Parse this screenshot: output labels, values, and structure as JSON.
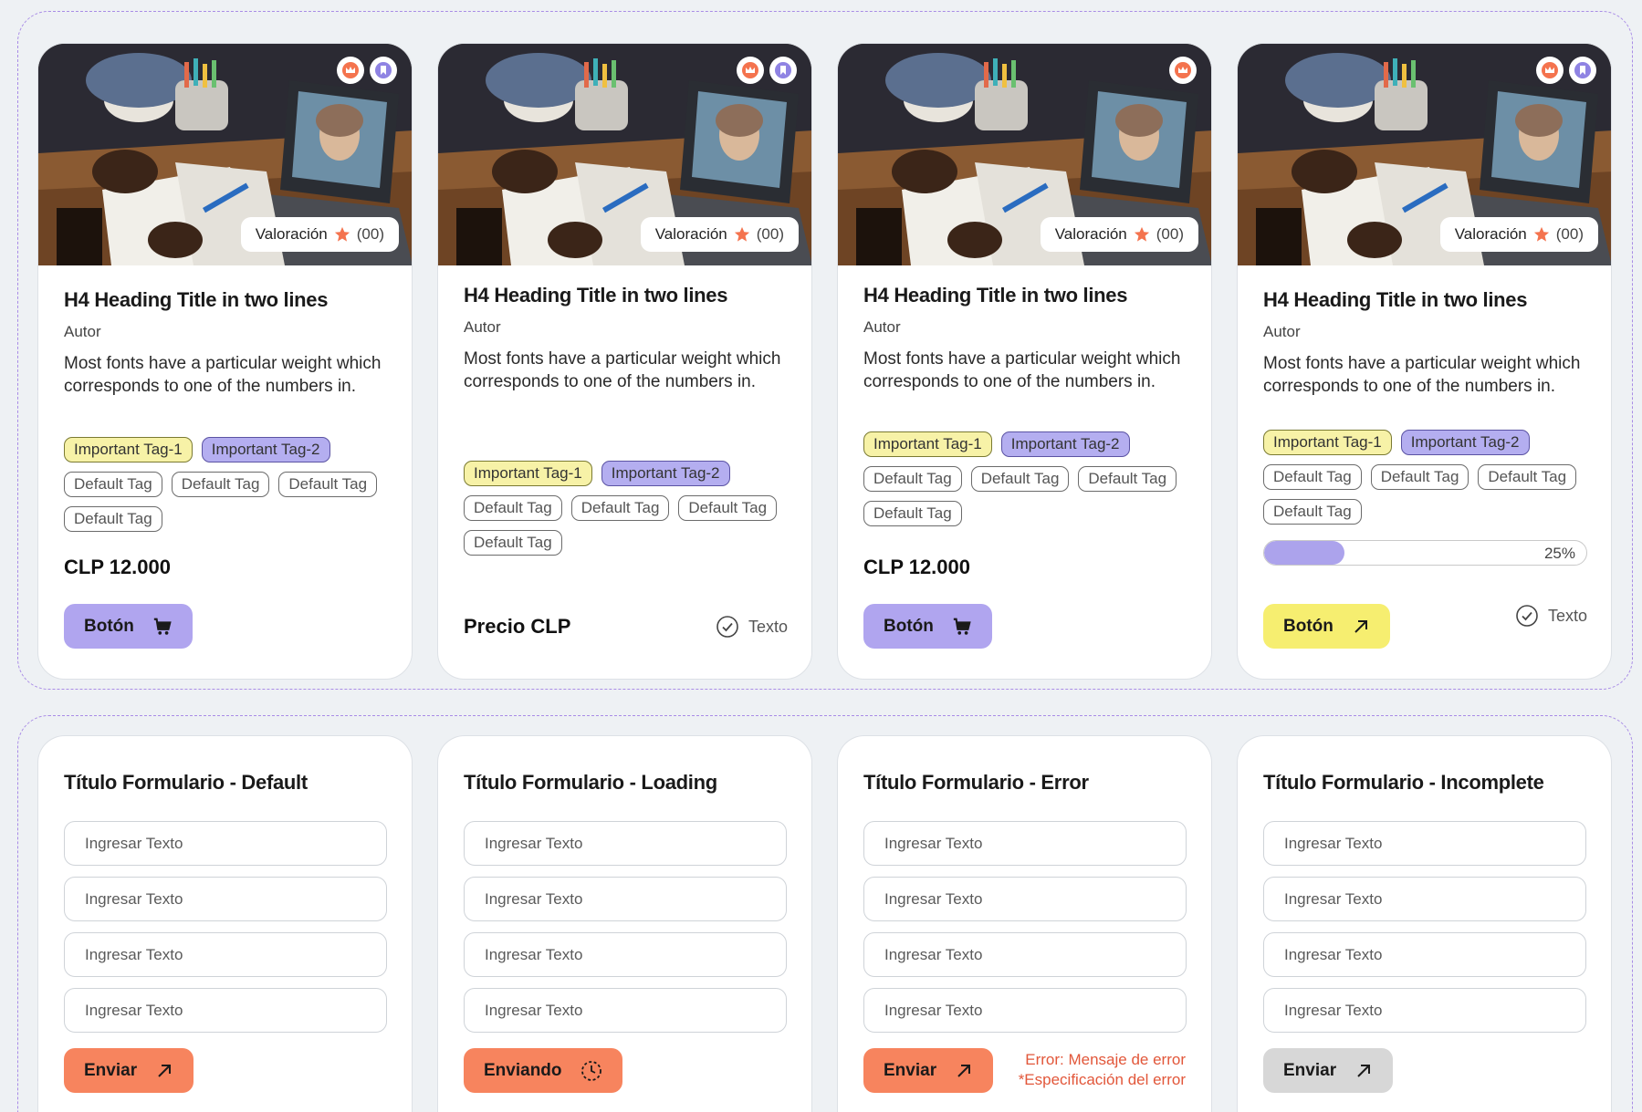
{
  "cards": [
    {
      "rating_label": "Valoración",
      "rating_count": "(00)",
      "title": "H4 Heading Title in two lines",
      "author": "Autor",
      "description": "Most fonts have a particular weight which corresponds to one of the numbers in.",
      "important_tags": [
        "Important Tag-1",
        "Important Tag-2"
      ],
      "default_tags": [
        "Default Tag",
        "Default Tag",
        "Default Tag",
        "Default Tag"
      ],
      "price": "CLP 12.000",
      "button_label": "Botón"
    },
    {
      "rating_label": "Valoración",
      "rating_count": "(00)",
      "title": "H4 Heading Title in two lines",
      "author": "Autor",
      "description": "Most fonts have a particular weight which corresponds to one of the numbers in.",
      "important_tags": [
        "Important Tag-1",
        "Important Tag-2"
      ],
      "default_tags": [
        "Default Tag",
        "Default Tag",
        "Default Tag",
        "Default Tag"
      ],
      "price": "Precio CLP",
      "check_text": "Texto"
    },
    {
      "rating_label": "Valoración",
      "rating_count": "(00)",
      "title": "H4 Heading Title in two lines",
      "author": "Autor",
      "description": "Most fonts have a particular weight which corresponds to one of the numbers in.",
      "important_tags": [
        "Important Tag-1",
        "Important Tag-2"
      ],
      "default_tags": [
        "Default Tag",
        "Default Tag",
        "Default Tag",
        "Default Tag"
      ],
      "price": "CLP 12.000",
      "button_label": "Botón"
    },
    {
      "rating_label": "Valoración",
      "rating_count": "(00)",
      "title": "H4 Heading Title in two lines",
      "author": "Autor",
      "description": "Most fonts have a particular weight which corresponds to one of the numbers in.",
      "important_tags": [
        "Important Tag-1",
        "Important Tag-2"
      ],
      "default_tags": [
        "Default Tag",
        "Default Tag",
        "Default Tag",
        "Default Tag"
      ],
      "progress_percent": 25,
      "progress_label": "25%",
      "button_label": "Botón",
      "check_text": "Texto"
    }
  ],
  "forms": [
    {
      "title": "Título Formulario - Default",
      "placeholders": [
        "Ingresar Texto",
        "Ingresar Texto",
        "Ingresar Texto",
        "Ingresar Texto"
      ],
      "button_label": "Enviar"
    },
    {
      "title": "Título Formulario - Loading",
      "placeholders": [
        "Ingresar Texto",
        "Ingresar Texto",
        "Ingresar Texto",
        "Ingresar Texto"
      ],
      "button_label": "Enviando"
    },
    {
      "title": "Título Formulario - Error",
      "placeholders": [
        "Ingresar Texto",
        "Ingresar Texto",
        "Ingresar Texto",
        "Ingresar Texto"
      ],
      "button_label": "Enviar",
      "error_line1": "Error: Mensaje de error",
      "error_line2": "*Especificación del error"
    },
    {
      "title": "Título Formulario - Incomplete",
      "placeholders": [
        "Ingresar Texto",
        "Ingresar Texto",
        "Ingresar Texto",
        "Ingresar Texto"
      ],
      "button_label": "Enviar"
    }
  ],
  "colors": {
    "purple_button": "#b0a5ef",
    "yellow_button": "#f6ee70",
    "orange_button": "#f7845e",
    "disabled_button": "#d7d7d7",
    "error_text": "#e2573a",
    "star": "#f4734e"
  },
  "icons": {
    "badge_crown": "crown-icon",
    "badge_bookmark": "bookmark-icon",
    "cart": "cart-icon",
    "arrow": "arrow-up-right-icon",
    "check": "check-circle-icon",
    "loading": "clock-loading-icon",
    "star": "star-icon"
  }
}
